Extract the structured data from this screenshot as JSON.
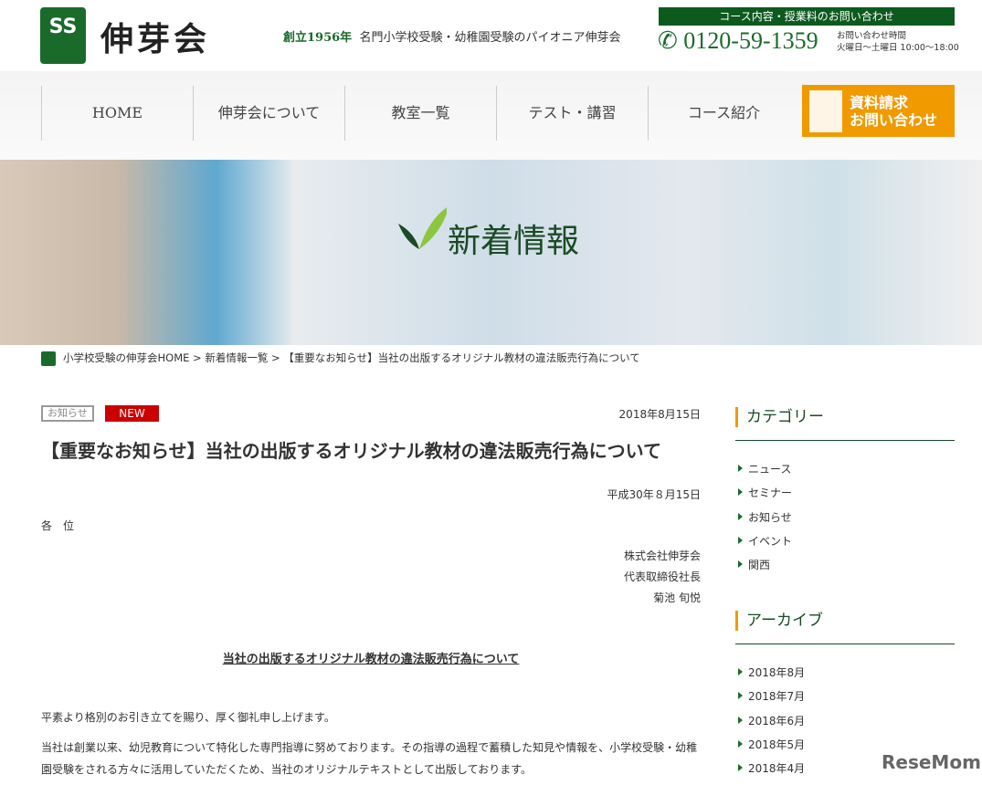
{
  "header": {
    "logo_text": "伸芽会",
    "logo_mark": "SS",
    "tagline_green": "創立1956年",
    "tagline": "名門小学校受験・幼稚園受験のパイオニア伸芽会",
    "contact_label": "コース内容・授業料のお問い合わせ",
    "phone": "0120-59-1359",
    "hours_label": "お問い合わせ時間",
    "hours": "火曜日～土曜日 10:00～18:00"
  },
  "nav": {
    "items": [
      "HOME",
      "伸芽会について",
      "教室一覧",
      "テスト・講習",
      "コース紹介"
    ],
    "cta_line1": "資料請求",
    "cta_line2": "お問い合わせ"
  },
  "hero": {
    "title": "新着情報"
  },
  "breadcrumb": {
    "home": "小学校受験の伸芽会HOME",
    "sep": ">",
    "list": "新着情報一覧",
    "current": "【重要なお知らせ】当社の出版するオリジナル教材の違法販売行為について"
  },
  "article": {
    "category": "お知らせ",
    "new_badge": "NEW",
    "date": "2018年8月15日",
    "title": "【重要なお知らせ】当社の出版するオリジナル教材の違法販売行為について",
    "letter_date": "平成30年８月15日",
    "addressee": "各　位",
    "company": "株式会社伸芽会",
    "position": "代表取締役社長",
    "name": "菊池 旬悦",
    "subject": "当社の出版するオリジナル教材の違法販売行為について",
    "para1": "平素より格別のお引き立てを賜り、厚く御礼申し上げます。",
    "para2a": "当社は創業以来、幼児教育について特化した専門指導に努めております。その指導の過程で蓄積した知見や情報を、小学校受験・幼稚",
    "para2b": "園受験をされる方々に活用していただくため、当社のオリジナルテキストとして出版しております。"
  },
  "sidebar": {
    "category_title": "カテゴリー",
    "categories": [
      "ニュース",
      "セミナー",
      "お知らせ",
      "イベント",
      "関西"
    ],
    "archive_title": "アーカイブ",
    "archives": [
      "2018年8月",
      "2018年7月",
      "2018年6月",
      "2018年5月",
      "2018年4月"
    ]
  },
  "watermark": "ReseMom"
}
